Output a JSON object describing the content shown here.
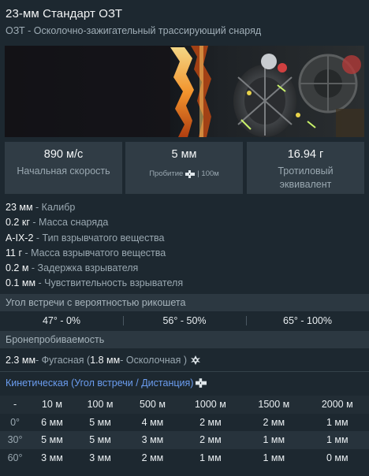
{
  "title": "23-мм Стандарт ОЗТ",
  "subtitle": "ОЗТ - Осколочно-зажигательный трассирующий снаряд",
  "stats": [
    {
      "value": "890 м/с",
      "label": "Начальная скорость"
    },
    {
      "value": "5 мм",
      "label_prefix": "Пробитие",
      "label_suffix": "| 100м",
      "icon": "shell-hit-icon"
    },
    {
      "value": "16.94 г",
      "label_line1": "Тротиловый",
      "label_line2": "эквивалент"
    }
  ],
  "properties": [
    {
      "value": "23 мм",
      "label": " - Калибр"
    },
    {
      "value": "0.2 кг",
      "label": " - Масса снаряда"
    },
    {
      "value": "A-IX-2",
      "label": " - Тип взрывчатого вещества"
    },
    {
      "value": "11 г",
      "label": " - Масса взрывчатого вещества"
    },
    {
      "value": "0.2 м",
      "label": " - Задержка взрывателя"
    },
    {
      "value": "0.1 мм",
      "label": " - Чувствительность взрывателя"
    }
  ],
  "ricochet": {
    "header": "Угол встречи с вероятностью рикошета",
    "values": [
      "47° - 0%",
      "56° - 50%",
      "65° - 100%"
    ]
  },
  "penetration": {
    "header": "Бронепробиваемость",
    "he_value": "2.3 мм",
    "he_label": " - Фугасная ( ",
    "frag_value": "1.8 мм",
    "frag_label": " - Осколочная )",
    "icon": "fragmentation-icon"
  },
  "kinetic": {
    "title": "Кинетическая (Угол встречи / Дистанция)",
    "icon": "shell-hit-icon",
    "corner": "-",
    "columns": [
      "10 м",
      "100 м",
      "500 м",
      "1000 м",
      "1500 м",
      "2000 м"
    ],
    "rows": [
      {
        "angle": "0°",
        "cells": [
          "6 мм",
          "5 мм",
          "4 мм",
          "2 мм",
          "2 мм",
          "1 мм"
        ]
      },
      {
        "angle": "30°",
        "cells": [
          "5 мм",
          "5 мм",
          "3 мм",
          "2 мм",
          "1 мм",
          "1 мм"
        ]
      },
      {
        "angle": "60°",
        "cells": [
          "3 мм",
          "3 мм",
          "2 мм",
          "1 мм",
          "1 мм",
          "0 мм"
        ]
      }
    ]
  },
  "colors": {
    "background": "#1d2830",
    "panel": "#303c45",
    "band": "#2c3841",
    "accent_blue": "#6b9df0",
    "text_muted": "#9aa8b1"
  }
}
